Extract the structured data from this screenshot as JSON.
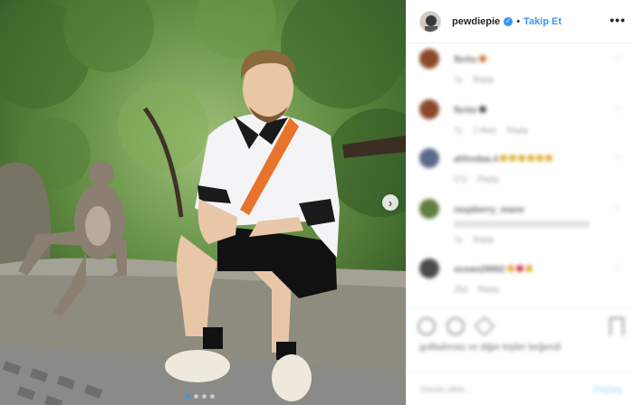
{
  "header": {
    "username": "pewdiepie",
    "verified_icon": "verified-badge-icon",
    "separator": "•",
    "follow_label": "Takip Et",
    "more_icon": "more-options-icon",
    "more_label": "•••"
  },
  "photo": {
    "next_icon": "chevron-right-icon",
    "next_label": "›",
    "slides": 4,
    "active_slide": 1
  },
  "comments": [
    {
      "name": "fbrito",
      "text": "",
      "emoji_colors": [
        "#c9773c"
      ],
      "meta": [
        "7y",
        "Reply"
      ],
      "avatar_color": "#8a4a2a"
    },
    {
      "name": "fbrito",
      "text": "",
      "emoji_colors": [
        "#555555"
      ],
      "meta": [
        "7y",
        "1 likes",
        "Reply"
      ],
      "avatar_color": "#8a4a2a"
    },
    {
      "name": "ahhxdaa.4",
      "text": "",
      "emoji_colors": [
        "#e0b23a",
        "#e0b23a",
        "#e0b23a",
        "#e0b23a",
        "#e0b23a",
        "#e0b23a"
      ],
      "meta": [
        "27y",
        "Reply"
      ],
      "avatar_color": "#5a6a8a"
    },
    {
      "name": "raspberry_mane",
      "text": "",
      "emoji_colors": [],
      "meta": [
        "7y",
        "Reply"
      ],
      "avatar_color": "#5e7f3e"
    },
    {
      "name": "ocean28882",
      "text": "",
      "emoji_colors": [
        "#e0b23a",
        "#d23b5a",
        "#e0b23a"
      ],
      "meta": [
        "25d",
        "Reply"
      ],
      "avatar_color": "#4a4a4a"
    }
  ],
  "actions": {
    "like_icon": "heart-icon",
    "comment_icon": "comment-icon",
    "share_icon": "share-icon",
    "save_icon": "bookmark-icon",
    "liked_by": "gullbahmaz ve diğer kişiler beğendi",
    "date": ""
  },
  "add_comment": {
    "placeholder": "Yorum ekle...",
    "post_label": "Paylaş"
  },
  "colors": {
    "accent": "#3897f0",
    "border": "#efefef"
  }
}
